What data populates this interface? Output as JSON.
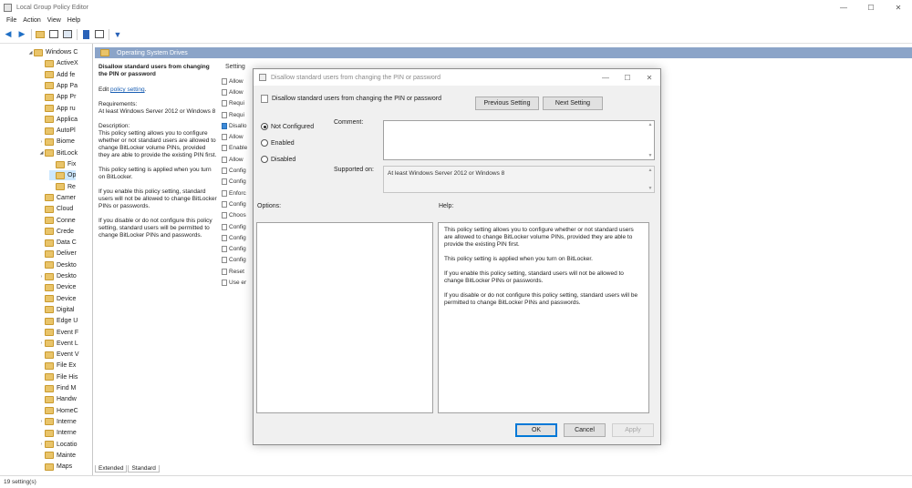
{
  "window": {
    "title": "Local Group Policy Editor",
    "minimize": "—",
    "maximize": "☐",
    "close": "✕"
  },
  "menu": [
    "File",
    "Action",
    "View",
    "Help"
  ],
  "tree": [
    {
      "label": "Windows C",
      "exp": "◢",
      "depth": 1,
      "folder": true
    },
    {
      "label": "ActiveX",
      "exp": "",
      "depth": 2
    },
    {
      "label": "Add fe",
      "exp": "",
      "depth": 2
    },
    {
      "label": "App Pa",
      "exp": "",
      "depth": 2
    },
    {
      "label": "App Pr",
      "exp": "",
      "depth": 2
    },
    {
      "label": "App ru",
      "exp": "",
      "depth": 2
    },
    {
      "label": "Applica",
      "exp": "",
      "depth": 2
    },
    {
      "label": "AutoPl",
      "exp": "",
      "depth": 2
    },
    {
      "label": "Biome",
      "exp": "›",
      "depth": 2
    },
    {
      "label": "BitLock",
      "exp": "◢",
      "depth": 2
    },
    {
      "label": "Fix",
      "exp": "",
      "depth": 3
    },
    {
      "label": "Op",
      "exp": "",
      "depth": 3,
      "selected": true
    },
    {
      "label": "Re",
      "exp": "",
      "depth": 3
    },
    {
      "label": "Camer",
      "exp": "",
      "depth": 2
    },
    {
      "label": "Cloud",
      "exp": "",
      "depth": 2
    },
    {
      "label": "Conne",
      "exp": "",
      "depth": 2
    },
    {
      "label": "Crede",
      "exp": "",
      "depth": 2
    },
    {
      "label": "Data C",
      "exp": "",
      "depth": 2
    },
    {
      "label": "Deliver",
      "exp": "",
      "depth": 2
    },
    {
      "label": "Deskto",
      "exp": "",
      "depth": 2
    },
    {
      "label": "Deskto",
      "exp": "›",
      "depth": 2
    },
    {
      "label": "Device",
      "exp": "",
      "depth": 2
    },
    {
      "label": "Device",
      "exp": "",
      "depth": 2
    },
    {
      "label": "Digital",
      "exp": "",
      "depth": 2
    },
    {
      "label": "Edge U",
      "exp": "",
      "depth": 2
    },
    {
      "label": "Event F",
      "exp": "",
      "depth": 2
    },
    {
      "label": "Event L",
      "exp": "›",
      "depth": 2
    },
    {
      "label": "Event V",
      "exp": "",
      "depth": 2
    },
    {
      "label": "File Ex",
      "exp": "",
      "depth": 2
    },
    {
      "label": "File His",
      "exp": "",
      "depth": 2
    },
    {
      "label": "Find M",
      "exp": "",
      "depth": 2
    },
    {
      "label": "Handw",
      "exp": "",
      "depth": 2
    },
    {
      "label": "HomeC",
      "exp": "",
      "depth": 2
    },
    {
      "label": "Interne",
      "exp": "›",
      "depth": 2
    },
    {
      "label": "Interne",
      "exp": "",
      "depth": 2
    },
    {
      "label": "Locatio",
      "exp": "›",
      "depth": 2
    },
    {
      "label": "Mainte",
      "exp": "",
      "depth": 2
    },
    {
      "label": "Maps",
      "exp": "",
      "depth": 2
    }
  ],
  "pane": {
    "header": "Operating System Drives",
    "policy_title": "Disallow standard users from changing the PIN or password",
    "edit_prefix": "Edit ",
    "edit_link": "policy setting",
    "edit_suffix": ".",
    "requirements_label": "Requirements:",
    "requirements": "At least Windows Server 2012 or Windows 8",
    "description_label": "Description:",
    "desc_p1": "This policy setting allows you to configure whether or not standard users are allowed to change BitLocker volume PINs, provided they are able to provide the existing PIN first.",
    "desc_p2": "This policy setting is applied when you turn on BitLocker.",
    "desc_p3": "If you enable this policy setting, standard users will not be allowed to change BitLocker PINs or passwords.",
    "desc_p4": "If you disable or do not configure this policy setting, standard users will be permitted to change BitLocker PINs and passwords.",
    "settings_header": "Setting",
    "settings": [
      "Allow",
      "Allow",
      "Requi",
      "Requi",
      "Disallo",
      "Allow",
      "Enable",
      "Allow",
      "Config",
      "Config",
      "Enforc",
      "Config",
      "Choos",
      "Config",
      "Config",
      "Config",
      "Config",
      "Reset",
      "Use er"
    ],
    "selected_setting": 4
  },
  "tabs": [
    "Extended",
    "Standard"
  ],
  "status": "19 setting(s)",
  "dialog": {
    "title": "Disallow standard users from changing the PIN or password",
    "heading": "Disallow standard users from changing the PIN or password",
    "prev_button": "Previous Setting",
    "next_button": "Next Setting",
    "radio_not_configured": "Not Configured",
    "radio_enabled": "Enabled",
    "radio_disabled": "Disabled",
    "comment_label": "Comment:",
    "supported_label": "Supported on:",
    "supported_value": "At least Windows Server 2012 or Windows 8",
    "options_label": "Options:",
    "help_label": "Help:",
    "help_p1": "This policy setting allows you to configure whether or not standard users are allowed to change BitLocker volume PINs, provided they are able to provide the existing PIN first.",
    "help_p2": "This policy setting is applied when you turn on BitLocker.",
    "help_p3": "If you enable this policy setting, standard users will not be allowed to change BitLocker PINs or passwords.",
    "help_p4": "If you disable or do not configure this policy setting, standard users will be permitted to change BitLocker PINs and passwords.",
    "ok": "OK",
    "cancel": "Cancel",
    "apply": "Apply"
  },
  "colors": {
    "pane_header": "#8ba4c8",
    "selection": "#cde8ff",
    "folder": "#e9c46a",
    "link": "#1a5fb4"
  }
}
